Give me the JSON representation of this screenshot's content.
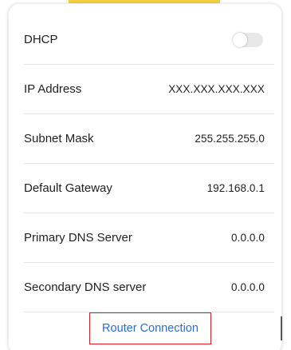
{
  "settings": {
    "dhcp": {
      "label": "DHCP",
      "enabled": false
    },
    "ip_address": {
      "label": "IP Address",
      "value": "XXX.XXX.XXX.XXX"
    },
    "subnet_mask": {
      "label": "Subnet Mask",
      "value": "255.255.255.0"
    },
    "default_gateway": {
      "label": "Default Gateway",
      "value": "192.168.0.1"
    },
    "primary_dns": {
      "label": "Primary DNS Server",
      "value": "0.0.0.0"
    },
    "secondary_dns": {
      "label": "Secondary DNS server",
      "value": "0.0.0.0"
    }
  },
  "router_connection_label": "Router Connection",
  "colors": {
    "accent_yellow": "#f4d03f",
    "link_blue": "#2b6cd6",
    "highlight_red": "#e0151d",
    "toggle_off": "#e8e8e8"
  }
}
